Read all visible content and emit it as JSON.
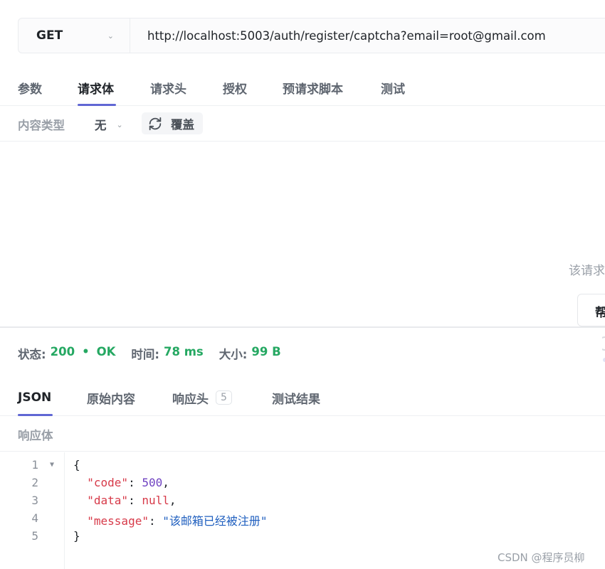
{
  "request": {
    "method": "GET",
    "url": "http://localhost:5003/auth/register/captcha?email=root@gmail.com"
  },
  "request_tabs": [
    "参数",
    "请求体",
    "请求头",
    "授权",
    "预请求脚本",
    "测试"
  ],
  "body_toolbar": {
    "content_type_label": "内容类型",
    "content_type_value": "无",
    "override_label": "覆盖"
  },
  "body_empty": {
    "message": "该请求",
    "help_label": "帮"
  },
  "status": {
    "status_label": "状态:",
    "status_code": "200",
    "status_text": "OK",
    "time_label": "时间:",
    "time_value": "78 ms",
    "size_label": "大小:",
    "size_value": "99 B"
  },
  "response_tabs": [
    {
      "label": "JSON"
    },
    {
      "label": "原始内容"
    },
    {
      "label": "响应头",
      "badge": "5"
    },
    {
      "label": "测试结果"
    }
  ],
  "response_body_label": "响应体",
  "code": {
    "line_numbers": [
      "1",
      "2",
      "3",
      "4",
      "5"
    ],
    "open_brace": "{",
    "close_brace": "}",
    "lines": [
      {
        "key": "\"code\"",
        "value": "500",
        "type": "number"
      },
      {
        "key": "\"data\"",
        "value": "null",
        "type": "null"
      },
      {
        "key": "\"message\"",
        "value": "\"该邮箱已经被注册\"",
        "type": "string"
      }
    ]
  },
  "watermark": "CSDN @程序员柳",
  "colors": {
    "accent": "#6067d4",
    "success": "#25a862",
    "json_key": "#d73a49",
    "json_number": "#6f42c1",
    "json_string": "#1f5fbf"
  }
}
